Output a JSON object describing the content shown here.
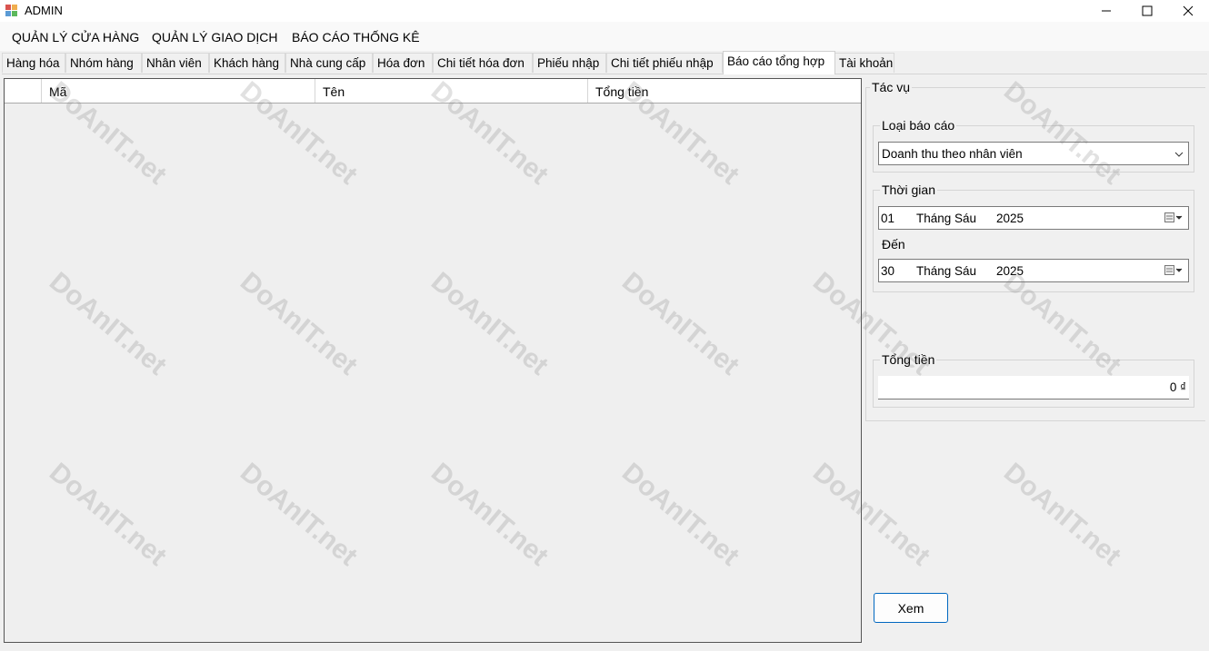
{
  "window": {
    "title": "ADMIN",
    "minimize_icon": "minimize-icon",
    "maximize_icon": "maximize-icon",
    "close_icon": "close-icon"
  },
  "menu": [
    "QUẢN LÝ CỬA HÀNG",
    "QUẢN LÝ GIAO DỊCH",
    "BÁO CÁO THỐNG KÊ"
  ],
  "tabs": [
    "Hàng hóa",
    "Nhóm hàng",
    "Nhân viên",
    "Khách hàng",
    "Nhà cung cấp",
    "Hóa đơn",
    "Chi tiết hóa đơn",
    "Phiếu nhập",
    "Chi tiết phiếu nhập",
    "Báo cáo tổng hợp",
    "Tài khoản"
  ],
  "active_tab": "Báo cáo tổng hợp",
  "grid": {
    "columns": [
      "Mã",
      "Tên",
      "Tổng tiền"
    ],
    "rows": []
  },
  "actions": {
    "title": "Tác vụ",
    "report_type": {
      "label": "Loại báo cáo",
      "selected": "Doanh thu theo nhân viên"
    },
    "time": {
      "label": "Thời gian",
      "from": {
        "day": "01",
        "month": "Tháng Sáu",
        "year": "2025"
      },
      "to_label": "Đến",
      "to": {
        "day": "30",
        "month": "Tháng Sáu",
        "year": "2025"
      }
    },
    "total": {
      "label": "Tổng tiền",
      "value": "0 ₫"
    },
    "view_button": "Xem"
  },
  "watermark": "DoAnIT.net",
  "colors": {
    "accent": "#0067c0",
    "window_bg": "#f0f0f0"
  }
}
